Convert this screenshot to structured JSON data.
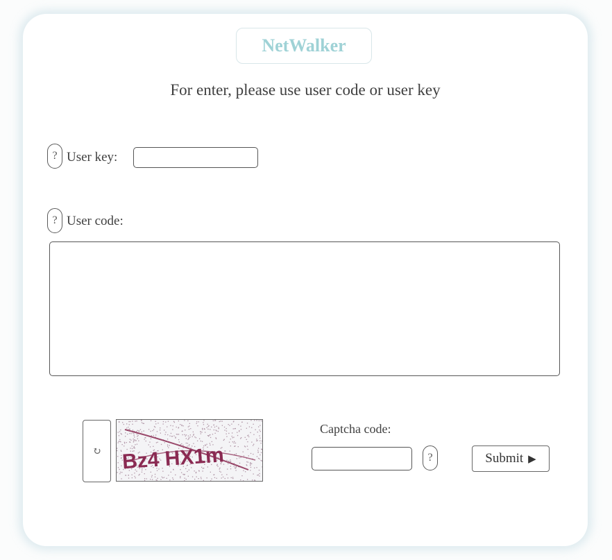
{
  "logo": {
    "text": "NetWalker"
  },
  "intro": "For enter, please use user code or user key",
  "user_key": {
    "help": "?",
    "label": "User key:",
    "value": ""
  },
  "user_code": {
    "help": "?",
    "label": "User code:",
    "value": ""
  },
  "captcha": {
    "refresh_icon": "refresh-icon",
    "refresh_glyph": "↻",
    "image_text": "Bz4 HX1m",
    "label": "Captcha code:",
    "help": "?",
    "value": ""
  },
  "submit": {
    "label": "Submit",
    "arrow": "▶"
  },
  "colors": {
    "logo": "#9fd2d6",
    "captcha_text": "#8a2a52",
    "card_glow": "#a0c8d7"
  }
}
